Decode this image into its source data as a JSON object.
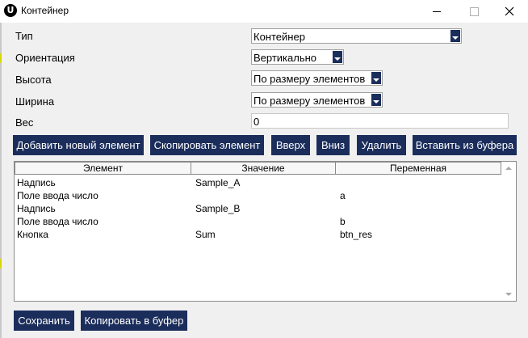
{
  "window": {
    "icon_letter": "U",
    "title": "Контейнер"
  },
  "form": {
    "type_label": "Тип",
    "type_value": "Контейнер",
    "orientation_label": "Ориентация",
    "orientation_value": "Вертикально",
    "height_label": "Высота",
    "height_value": "По размеру элементов",
    "width_label": "Ширина",
    "width_value": "По размеру элементов",
    "weight_label": "Вес",
    "weight_value": "0"
  },
  "toolbar": {
    "add": "Добавить новый элемент",
    "copy": "Скопировать элемент",
    "up": "Вверх",
    "down": "Вниз",
    "delete": "Удалить",
    "paste": "Вставить из буфера"
  },
  "table": {
    "headers": [
      "Элемент",
      "Значение",
      "Переменная"
    ],
    "rows": [
      [
        "Надпись",
        "Sample_A",
        ""
      ],
      [
        "Поле ввода число",
        "",
        "a"
      ],
      [
        "Надпись",
        "Sample_B",
        ""
      ],
      [
        "Поле ввода число",
        "",
        "b"
      ],
      [
        "Кнопка",
        "Sum",
        "btn_res"
      ]
    ]
  },
  "footer": {
    "save": "Сохранить",
    "copy_to_buffer": "Копировать в буфер"
  },
  "colors": {
    "accent": "#1b2d5b",
    "background": "#f0f0f0"
  }
}
